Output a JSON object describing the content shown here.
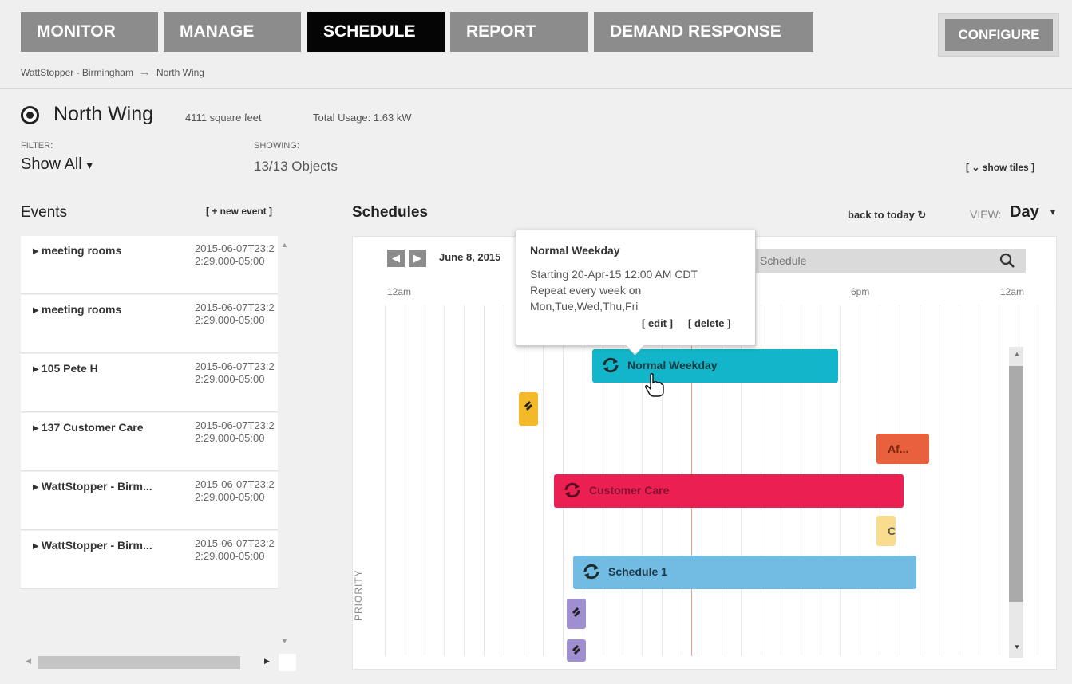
{
  "nav": {
    "tabs": [
      {
        "label": "MONITOR"
      },
      {
        "label": "MANAGE"
      },
      {
        "label": "SCHEDULE",
        "active": true
      },
      {
        "label": "REPORT"
      },
      {
        "label": "DEMAND RESPONSE"
      }
    ],
    "configure": "CONFIGURE"
  },
  "breadcrumb": {
    "root": "WattStopper - Birmingham",
    "current": "North Wing"
  },
  "header": {
    "title": "North Wing",
    "sqft": "4111 square feet",
    "usage": "Total Usage: 1.63 kW",
    "filter_label": "FILTER:",
    "filter_value": "Show All",
    "showing_label": "SHOWING:",
    "showing_value": "13/13 Objects",
    "show_tiles": "[ ⌄ show tiles ]"
  },
  "events": {
    "title": "Events",
    "new_event": "[ + new event ]",
    "items": [
      {
        "name": "▸ meeting rooms",
        "date": "2015-06-07T23:22:29.000-05:00"
      },
      {
        "name": "▸ meeting rooms",
        "date": "2015-06-07T23:22:29.000-05:00"
      },
      {
        "name": "▸ 105 Pete H",
        "date": "2015-06-07T23:22:29.000-05:00"
      },
      {
        "name": "▸ 137 Customer Care",
        "date": "2015-06-07T23:22:29.000-05:00"
      },
      {
        "name": "▸ WattStopper - Birm...",
        "date": "2015-06-07T23:22:29.000-05:00"
      },
      {
        "name": "▸ WattStopper - Birm...",
        "date": "2015-06-07T23:22:29.000-05:00"
      }
    ]
  },
  "schedules": {
    "title": "Schedules",
    "back_to_today": "back to today ↻",
    "view_label": "VIEW:",
    "view_value": "Day",
    "date": "June 8, 2015",
    "search_placeholder": "Schedule",
    "hours": {
      "start": "12am",
      "mid": "6pm",
      "end": "12am"
    },
    "priority_label": "PRIORITY",
    "bars": [
      {
        "label": "Normal Weekday",
        "color": "#12b5c9"
      },
      {
        "label": "",
        "color": "#f3b928"
      },
      {
        "label": "Af...",
        "color": "#e8603c"
      },
      {
        "label": "Customer Care",
        "color": "#ec1f52"
      },
      {
        "label": "C",
        "color": "#f9dc8e"
      },
      {
        "label": "Schedule 1",
        "color": "#72bbe2"
      },
      {
        "label": "",
        "color": "#9f8fd0"
      },
      {
        "label": "",
        "color": "#9f8fd0"
      }
    ]
  },
  "tooltip": {
    "title": "Normal Weekday",
    "line1": "Starting 20-Apr-15 12:00 AM CDT",
    "line2": "Repeat every week on",
    "line3": "Mon,Tue,Wed,Thu,Fri",
    "edit": "[ edit ]",
    "delete": "[ delete ]"
  }
}
